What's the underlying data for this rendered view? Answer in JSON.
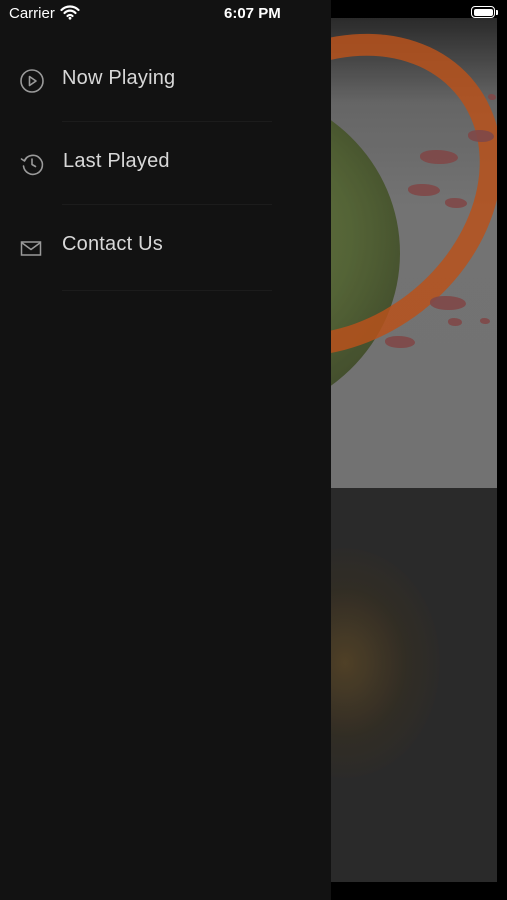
{
  "status_bar": {
    "carrier": "Carrier",
    "time": "6:07 PM",
    "wifi_icon": "wifi-icon",
    "battery_icon": "battery-icon"
  },
  "drawer": {
    "items": [
      {
        "label": "Now Playing",
        "icon": "play-circle-icon"
      },
      {
        "label": "Last Played",
        "icon": "history-icon"
      },
      {
        "label": "Contact Us",
        "icon": "envelope-icon"
      }
    ]
  },
  "colors": {
    "drawer_background": "#121212",
    "menu_text": "#d8d8d8",
    "icon_stroke": "#9a9a9a",
    "ring_accent": "#c8591e",
    "planet_green": "#566a30"
  }
}
